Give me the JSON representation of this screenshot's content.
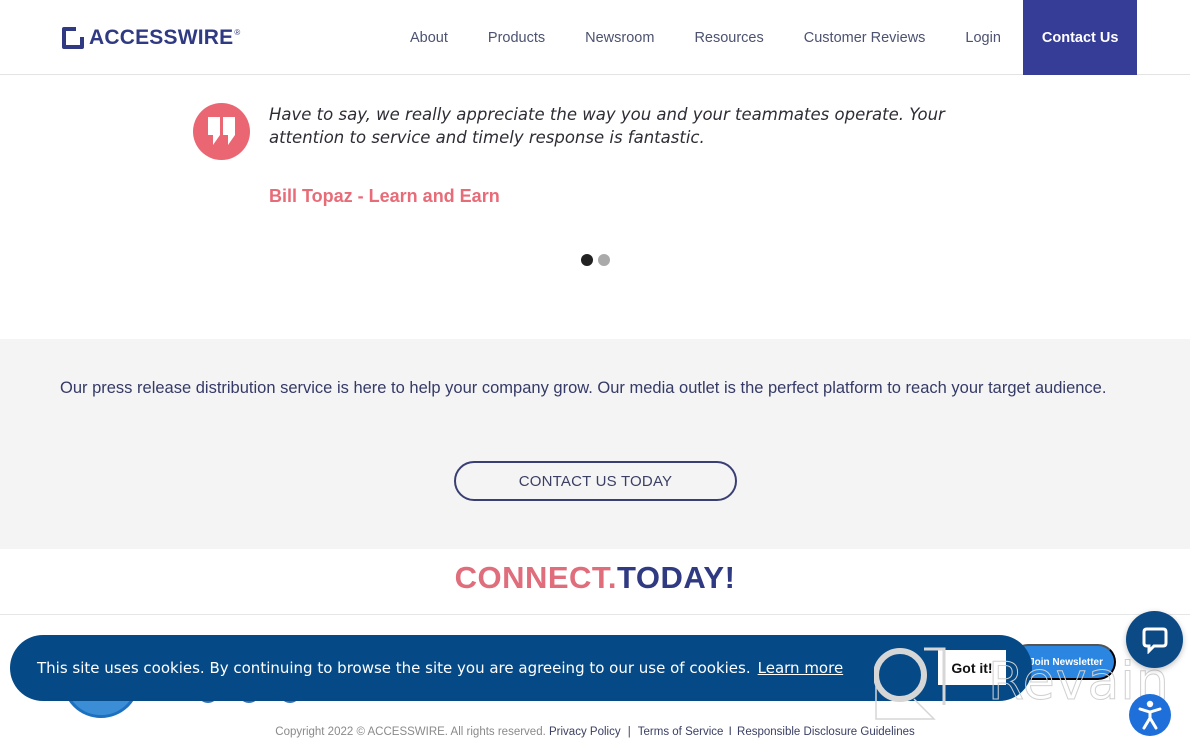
{
  "header": {
    "logo_text": "ACCESSWIRE",
    "logo_reg": "®",
    "nav": [
      {
        "label": "About"
      },
      {
        "label": "Products"
      },
      {
        "label": "Newsroom"
      },
      {
        "label": "Resources"
      },
      {
        "label": "Customer Reviews"
      },
      {
        "label": "Login"
      }
    ],
    "contact_label": "Contact Us"
  },
  "testimonial": {
    "quote": "Have to say, we really appreciate the way you and your teammates operate. Your attention to service and timely response is fantastic.",
    "author": "Bill Topaz - Learn and Earn",
    "slides_total": 2,
    "active_slide": 1
  },
  "cta": {
    "text": "Our press release distribution service is here to help your company grow. Our media outlet is the perfect platform to reach your target audience.",
    "button_label": "CONTACT US TODAY"
  },
  "connect": {
    "part1": "CONNECT.",
    "part2": "TODAY!"
  },
  "footer": {
    "copyright": "Copyright 2022 © ACCESSWIRE. All rights reserved.",
    "links": [
      "Privacy Policy",
      "Terms of Service",
      "Responsible Disclosure Guidelines"
    ],
    "separators": [
      "|",
      "I"
    ]
  },
  "cookie": {
    "text": "This site uses cookies. By continuing to browse the site you are agreeing to our use of cookies.",
    "link_label": "Learn more",
    "button_label": "Got it!"
  },
  "newsletter": {
    "label": "Join Newsletter"
  },
  "watermark": {
    "text": "Revain"
  },
  "colors": {
    "brand_navy": "#2f3a82",
    "contact_bg": "#363d96",
    "accent_pink": "#ea6673",
    "cookie_bg": "#054a86",
    "newsletter_bg": "#2a86e0",
    "chat_bg": "#0c4a86",
    "accessibility_bg": "#1e6fd9"
  },
  "icons": {
    "quote": "quote-icon",
    "chat": "chat-bubble-icon",
    "accessibility": "accessibility-person-icon"
  }
}
